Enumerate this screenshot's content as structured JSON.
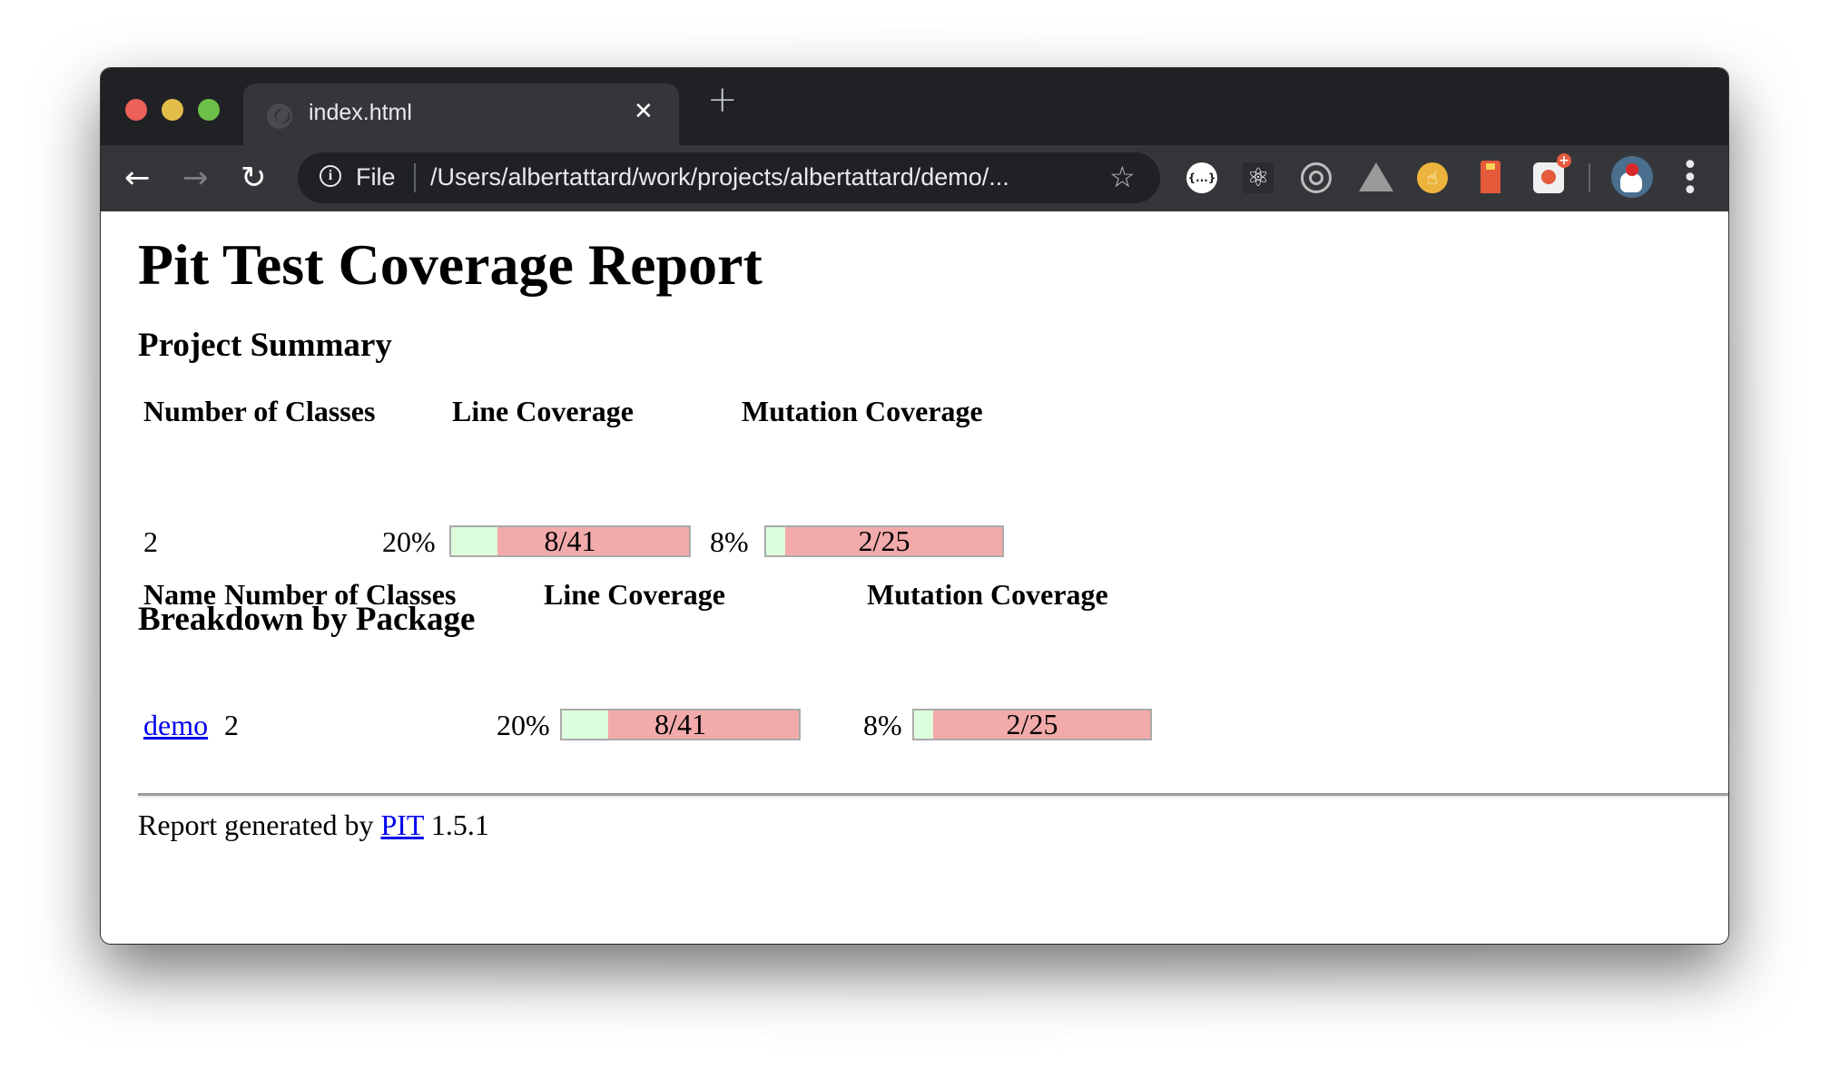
{
  "browser": {
    "tab": {
      "title": "index.html",
      "icon": "globe-icon",
      "close_glyph": "✕"
    },
    "new_tab_glyph": "+",
    "nav": {
      "back_glyph": "←",
      "forward_glyph": "→",
      "reload_glyph": "↻"
    },
    "address": {
      "info_glyph": "i",
      "scheme_label": "File",
      "url": "/Users/albertattard/work/projects/albertattard/demo/...",
      "star_glyph": "☆"
    },
    "extensions": [
      {
        "name": "json-formatter-icon",
        "glyph": "{...}"
      },
      {
        "name": "react-devtools-icon",
        "glyph": "⚛"
      },
      {
        "name": "target-icon",
        "glyph": ""
      },
      {
        "name": "google-drive-icon",
        "glyph": ""
      },
      {
        "name": "hand-icon",
        "glyph": "☝"
      },
      {
        "name": "lighthouse-icon",
        "glyph": ""
      },
      {
        "name": "sitemap-icon",
        "glyph": ""
      }
    ],
    "menu_glyph": "⋮"
  },
  "page": {
    "title": "Pit Test Coverage Report",
    "project_summary": {
      "heading": "Project Summary",
      "headers": [
        "Number of Classes",
        "Line Coverage",
        "Mutation Coverage"
      ],
      "number_of_classes": "2",
      "line_coverage": {
        "percent_label": "20%",
        "fraction_label": "8/41",
        "covered": 8,
        "total": 41
      },
      "mutation_coverage": {
        "percent_label": "8%",
        "fraction_label": "2/25",
        "covered": 2,
        "total": 25
      }
    },
    "breakdown": {
      "heading": "Breakdown by Package",
      "headers": [
        "Name",
        "Number of Classes",
        "Line Coverage",
        "Mutation Coverage"
      ],
      "rows": [
        {
          "name": "demo",
          "number_of_classes": "2",
          "line_coverage": {
            "percent_label": "20%",
            "fraction_label": "8/41",
            "covered": 8,
            "total": 41
          },
          "mutation_coverage": {
            "percent_label": "8%",
            "fraction_label": "2/25",
            "covered": 2,
            "total": 25
          }
        }
      ]
    },
    "footer": {
      "prefix": "Report generated by",
      "link_label": "PIT",
      "version": "1.5.1"
    }
  },
  "colors": {
    "covered": "#ddfedd",
    "uncovered": "#f2aaaa",
    "link": "#0000ee"
  }
}
